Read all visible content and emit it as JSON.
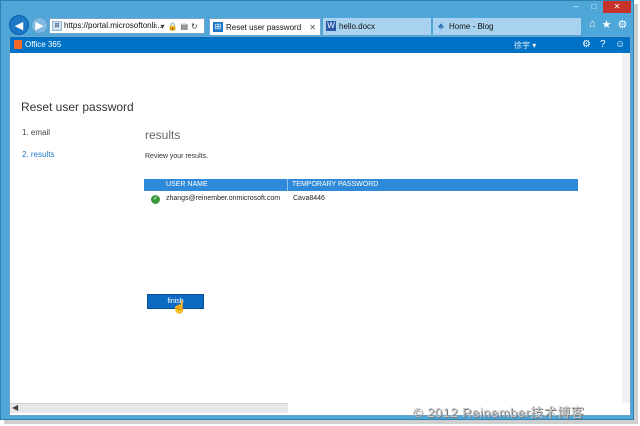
{
  "browser": {
    "address_url": "https://portal.microsoftonli...",
    "tabs": [
      {
        "label": "Reset user password",
        "active": true
      },
      {
        "label": "hello.docx"
      },
      {
        "label": "Home - Blog"
      }
    ],
    "window": {
      "minimize": "–",
      "maximize": "□",
      "close": "✕"
    },
    "toolbar_icons": [
      "home-icon",
      "star-icon",
      "gear-icon"
    ]
  },
  "o365": {
    "brand": "Office 365",
    "user": "徐宇",
    "user_caret": "▾",
    "icons": [
      "gear-icon",
      "help-icon",
      "smile-icon"
    ],
    "help_glyph": "?"
  },
  "page": {
    "heading": "Reset user password",
    "steps": [
      {
        "label": "1.  email",
        "state": "done"
      },
      {
        "label": "2.  results",
        "state": "current"
      }
    ],
    "section_title": "results",
    "review_text": "Review your results.",
    "table": {
      "columns": [
        "USER NAME",
        "TEMPORARY PASSWORD"
      ],
      "rows": [
        {
          "status": "success",
          "user": "zhangs@reinember.onmicrosoft.com",
          "password": "Cava8446"
        }
      ]
    },
    "finish_label": "finish"
  },
  "watermark": "© 2012 Reinember技术博客",
  "colors": {
    "accent": "#0072c6",
    "header_blue": "#2e8ad8",
    "success": "#3a9a3a",
    "link": "#1e78c8"
  }
}
